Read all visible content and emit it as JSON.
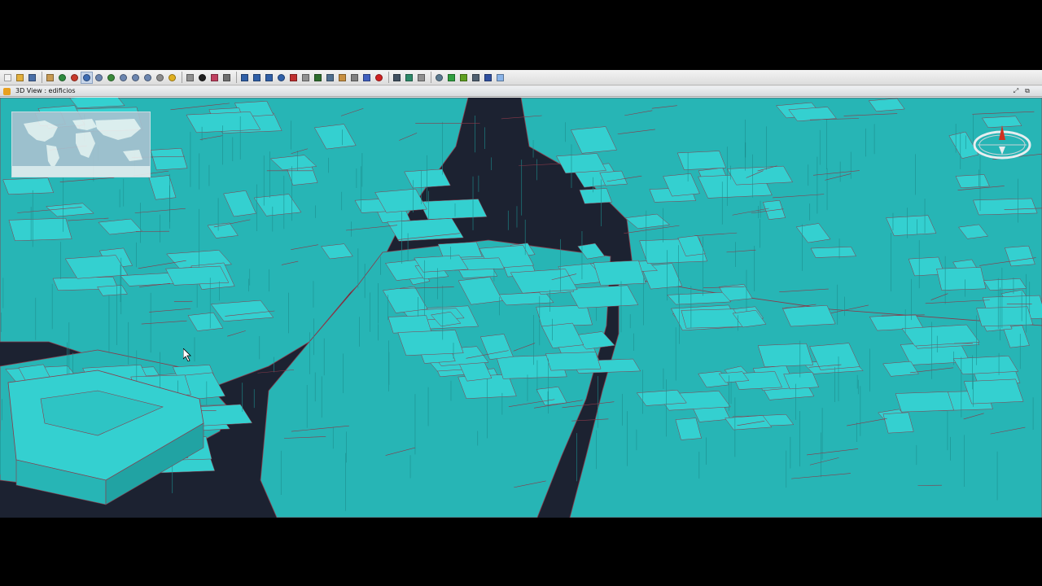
{
  "window": {
    "title": "3D View : edificios"
  },
  "toolbar": {
    "groups": [
      [
        {
          "name": "new-icon",
          "color": "#f2f2f2"
        },
        {
          "name": "open-icon",
          "color": "#e3b03c"
        },
        {
          "name": "save-icon",
          "color": "#4a6fa8"
        }
      ],
      [
        {
          "name": "pan-icon",
          "color": "#c89a52"
        },
        {
          "name": "zoom-extent-icon",
          "color": "#2e8b3e"
        },
        {
          "name": "zoom-select-icon",
          "color": "#c83a2a"
        },
        {
          "name": "zoom-window-icon",
          "color": "#3c6cb4",
          "selected": true
        },
        {
          "name": "zoom-in-icon",
          "color": "#6c86b0"
        },
        {
          "name": "globe-view-icon",
          "color": "#3a8a3a"
        },
        {
          "name": "zoom-out-icon",
          "color": "#6c86b0"
        },
        {
          "name": "zoom-previous-icon",
          "color": "#6c86b0"
        },
        {
          "name": "zoom-next-icon",
          "color": "#6c86b0"
        },
        {
          "name": "refresh-icon",
          "color": "#8c8c8c"
        },
        {
          "name": "locator-icon",
          "color": "#e0b020"
        }
      ],
      [
        {
          "name": "measure-icon",
          "color": "#909090"
        },
        {
          "name": "info-icon",
          "color": "#202020"
        },
        {
          "name": "table-icon",
          "color": "#c04060"
        },
        {
          "name": "print-icon",
          "color": "#707070"
        }
      ],
      [
        {
          "name": "select-icon",
          "color": "#3060a8"
        },
        {
          "name": "select-rect-icon",
          "color": "#3060a8"
        },
        {
          "name": "select-polygon-icon",
          "color": "#3060a8"
        },
        {
          "name": "select-circle-icon",
          "color": "#3060a8"
        },
        {
          "name": "select-by-layer-icon",
          "color": "#c03030"
        },
        {
          "name": "select-point-icon",
          "color": "#909090"
        },
        {
          "name": "select-all-icon",
          "color": "#2e6e2e"
        },
        {
          "name": "select-buffer-icon",
          "color": "#507090"
        },
        {
          "name": "clear-selection-icon",
          "color": "#c89040"
        },
        {
          "name": "invert-selection-icon",
          "color": "#808080"
        },
        {
          "name": "filter-icon",
          "color": "#4060c0"
        },
        {
          "name": "stop-icon",
          "color": "#d02020"
        }
      ],
      [
        {
          "name": "tools-icon",
          "color": "#405060"
        },
        {
          "name": "layers-icon",
          "color": "#2e8a6a"
        },
        {
          "name": "edit-icon",
          "color": "#909090"
        }
      ],
      [
        {
          "name": "globe-icon",
          "color": "#5a7a90"
        },
        {
          "name": "terrain-icon",
          "color": "#30a040"
        },
        {
          "name": "tree-icon",
          "color": "#60a020"
        },
        {
          "name": "camera-icon",
          "color": "#506070"
        },
        {
          "name": "monitor-icon",
          "color": "#3050a0"
        },
        {
          "name": "panel-icon",
          "color": "#8ab4e8"
        }
      ]
    ]
  },
  "controls": {
    "restore_glyph": "⤢",
    "close_glyph": "⧉"
  },
  "colors": {
    "building_face": "#27b5b5",
    "building_roof": "#34d0d0",
    "building_edge": "#8a3a4a",
    "background": "#1c2231",
    "compass_ring": "#e8eef0",
    "compass_needle": "#d03020"
  },
  "minimap": {
    "icon": "world-map-icon"
  },
  "compass": {
    "icon": "compass-icon"
  }
}
